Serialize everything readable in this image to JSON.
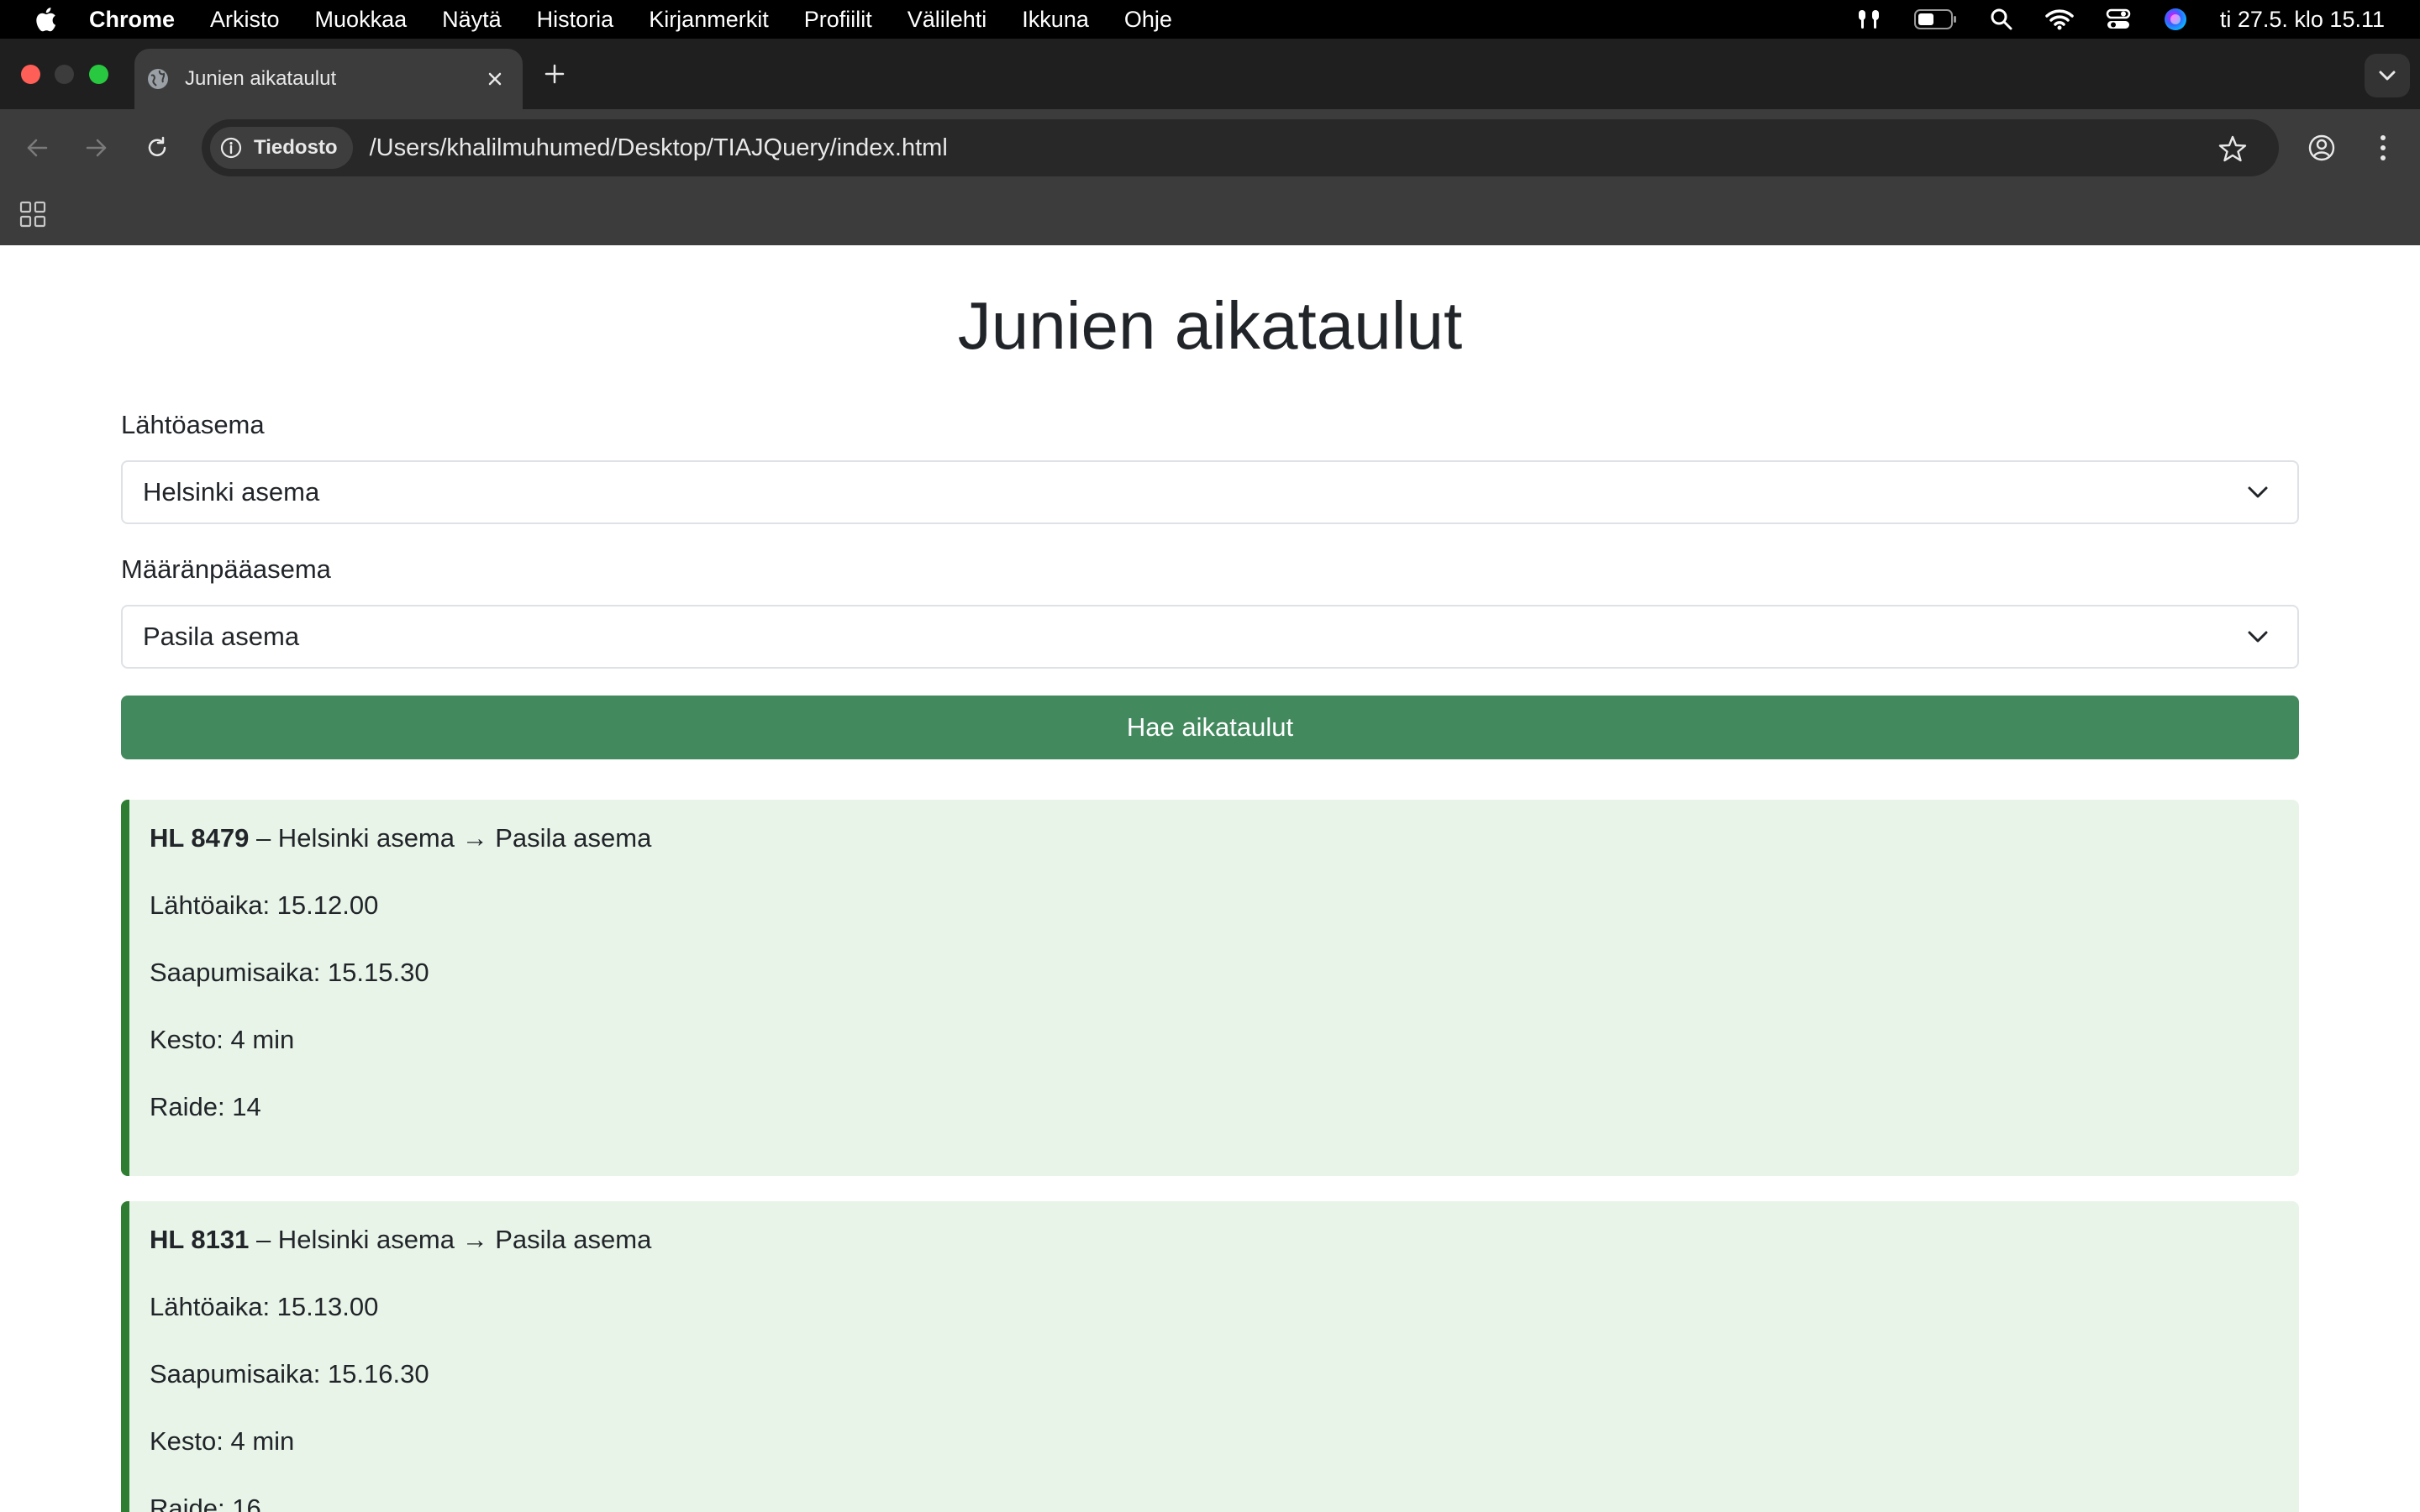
{
  "menubar": {
    "app_name": "Chrome",
    "items": [
      "Arkisto",
      "Muokkaa",
      "Näytä",
      "Historia",
      "Kirjanmerkit",
      "Profiilit",
      "Välilehti",
      "Ikkuna",
      "Ohje"
    ],
    "clock": "ti 27.5. klo 15.11"
  },
  "browser": {
    "tab_title": "Junien aikataulut",
    "security_chip": "Tiedosto",
    "url": "/Users/khalilmuhumed/Desktop/TIAJQuery/index.html"
  },
  "page": {
    "title": "Junien aikataulut",
    "departure_label": "Lähtöasema",
    "departure_value": "Helsinki asema",
    "destination_label": "Määränpääasema",
    "destination_value": "Pasila asema",
    "search_button": "Hae aikataulut"
  },
  "results": [
    {
      "train": "HL 8479",
      "route": " – Helsinki asema → Pasila asema",
      "departure": "Lähtöaika: 15.12.00",
      "arrival": "Saapumisaika: 15.15.30",
      "duration": "Kesto: 4 min",
      "track": "Raide: 14"
    },
    {
      "train": "HL 8131",
      "route": " – Helsinki asema → Pasila asema",
      "departure": "Lähtöaika: 15.13.00",
      "arrival": "Saapumisaika: 15.16.30",
      "duration": "Kesto: 4 min",
      "track": "Raide: 16"
    }
  ],
  "colors": {
    "accent_button": "#43895e",
    "card_background": "#e9f4e9",
    "card_border": "#2e7d32"
  }
}
